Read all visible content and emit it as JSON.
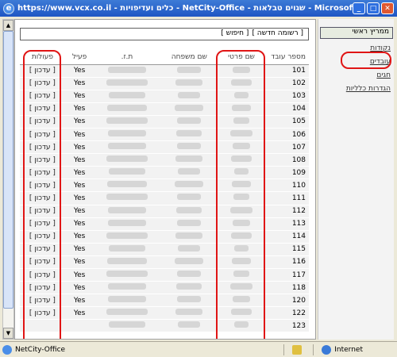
{
  "window": {
    "title": "https://www.vcx.co.il - כלים ועדיפויות - NetCity-Office - שגוים טבלאות - Microsoft Internet Explorer",
    "controls": {
      "minimize": "_",
      "maximize": "□",
      "close": "✕"
    },
    "icon": "ie-icon"
  },
  "toolbar": {
    "new_record": "[ רשומה חדשה ]",
    "search": "[ חיפוש ]"
  },
  "table": {
    "headers": {
      "id": "מספר עובד",
      "first_name": "שם פרטי",
      "last_name": "שם משפחה",
      "tz": "ת.ז.",
      "active": "פעיל",
      "actions": "פעולות"
    },
    "rows": [
      {
        "id": "101",
        "active": "Yes",
        "action": "[ עדכון ]"
      },
      {
        "id": "102",
        "active": "Yes",
        "action": "[ עדכון ]"
      },
      {
        "id": "103",
        "active": "Yes",
        "action": "[ עדכון ]"
      },
      {
        "id": "104",
        "active": "Yes",
        "action": "[ עדכון ]"
      },
      {
        "id": "105",
        "active": "Yes",
        "action": "[ עדכון ]"
      },
      {
        "id": "106",
        "active": "Yes",
        "action": "[ עדכון ]"
      },
      {
        "id": "107",
        "active": "Yes",
        "action": "[ עדכון ]"
      },
      {
        "id": "108",
        "active": "Yes",
        "action": "[ עדכון ]"
      },
      {
        "id": "109",
        "active": "Yes",
        "action": "[ עדכון ]"
      },
      {
        "id": "110",
        "active": "Yes",
        "action": "[ עדכון ]"
      },
      {
        "id": "111",
        "active": "Yes",
        "action": "[ עדכון ]"
      },
      {
        "id": "112",
        "active": "Yes",
        "action": "[ עדכון ]"
      },
      {
        "id": "113",
        "active": "Yes",
        "action": "[ עדכון ]"
      },
      {
        "id": "114",
        "active": "Yes",
        "action": "[ עדכון ]"
      },
      {
        "id": "115",
        "active": "Yes",
        "action": "[ עדכון ]"
      },
      {
        "id": "116",
        "active": "Yes",
        "action": "[ עדכון ]"
      },
      {
        "id": "117",
        "active": "Yes",
        "action": "[ עדכון ]"
      },
      {
        "id": "118",
        "active": "Yes",
        "action": "[ עדכון ]"
      },
      {
        "id": "120",
        "active": "Yes",
        "action": "[ עדכון ]"
      },
      {
        "id": "122",
        "active": "Yes",
        "action": "[ עדכון ]"
      },
      {
        "id": "123",
        "active": "",
        "action": ""
      }
    ]
  },
  "sidebar": {
    "top": "ממריץ ראשי",
    "items": [
      "נקודות",
      "עובדים",
      "חגים",
      "הגדרות כלליות"
    ]
  },
  "status": {
    "left": "NetCity-Office",
    "zone": "Internet"
  },
  "colors": {
    "highlight": "#e01515",
    "titlebar": "#1f56c4"
  }
}
